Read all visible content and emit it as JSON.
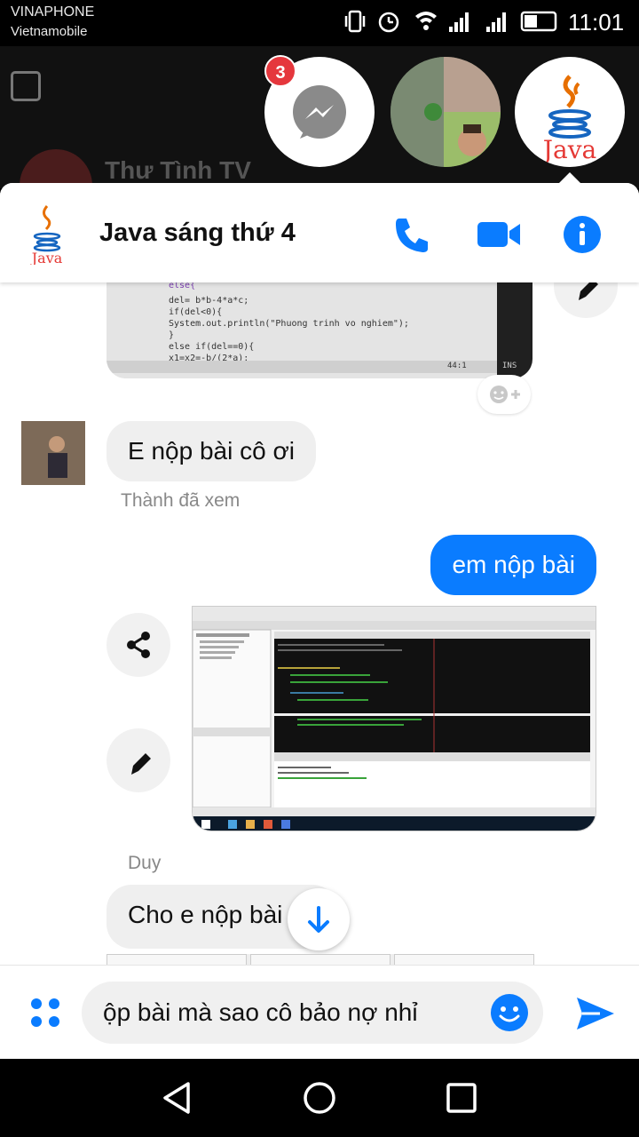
{
  "status_bar": {
    "carrier_primary": "VINAPHONE",
    "carrier_secondary": "Vietnamobile",
    "time": "11:01"
  },
  "background_chat": {
    "title": "Thư Tình TV"
  },
  "chat_heads": {
    "unread_badge": "3"
  },
  "header": {
    "title": "Java sáng thứ 4"
  },
  "messages": {
    "code_lines": [
      "}",
      "else{",
      "    del= b*b-4*a*c;",
      "    if(del<0){",
      "        System.out.println(\"Phuong trinh vo nghiem\");",
      "    }",
      "    else if(del==0){",
      "        x1=x2=-b/(2*a);"
    ],
    "code_status": "44:1",
    "code_mode": "INS",
    "incoming_text": "E nộp bài cô ơi",
    "seen_by": "Thành đã xem",
    "outgoing_text": "em nộp bài",
    "sender_name": "Duy",
    "incoming_text_2": "Cho e nộp bài"
  },
  "composer": {
    "input_value": "ộp bài mà sao cô bảo nợ nhỉ"
  },
  "colors": {
    "accent": "#0a7cff",
    "badge": "#e5373d",
    "bubble_in": "#efefef"
  }
}
